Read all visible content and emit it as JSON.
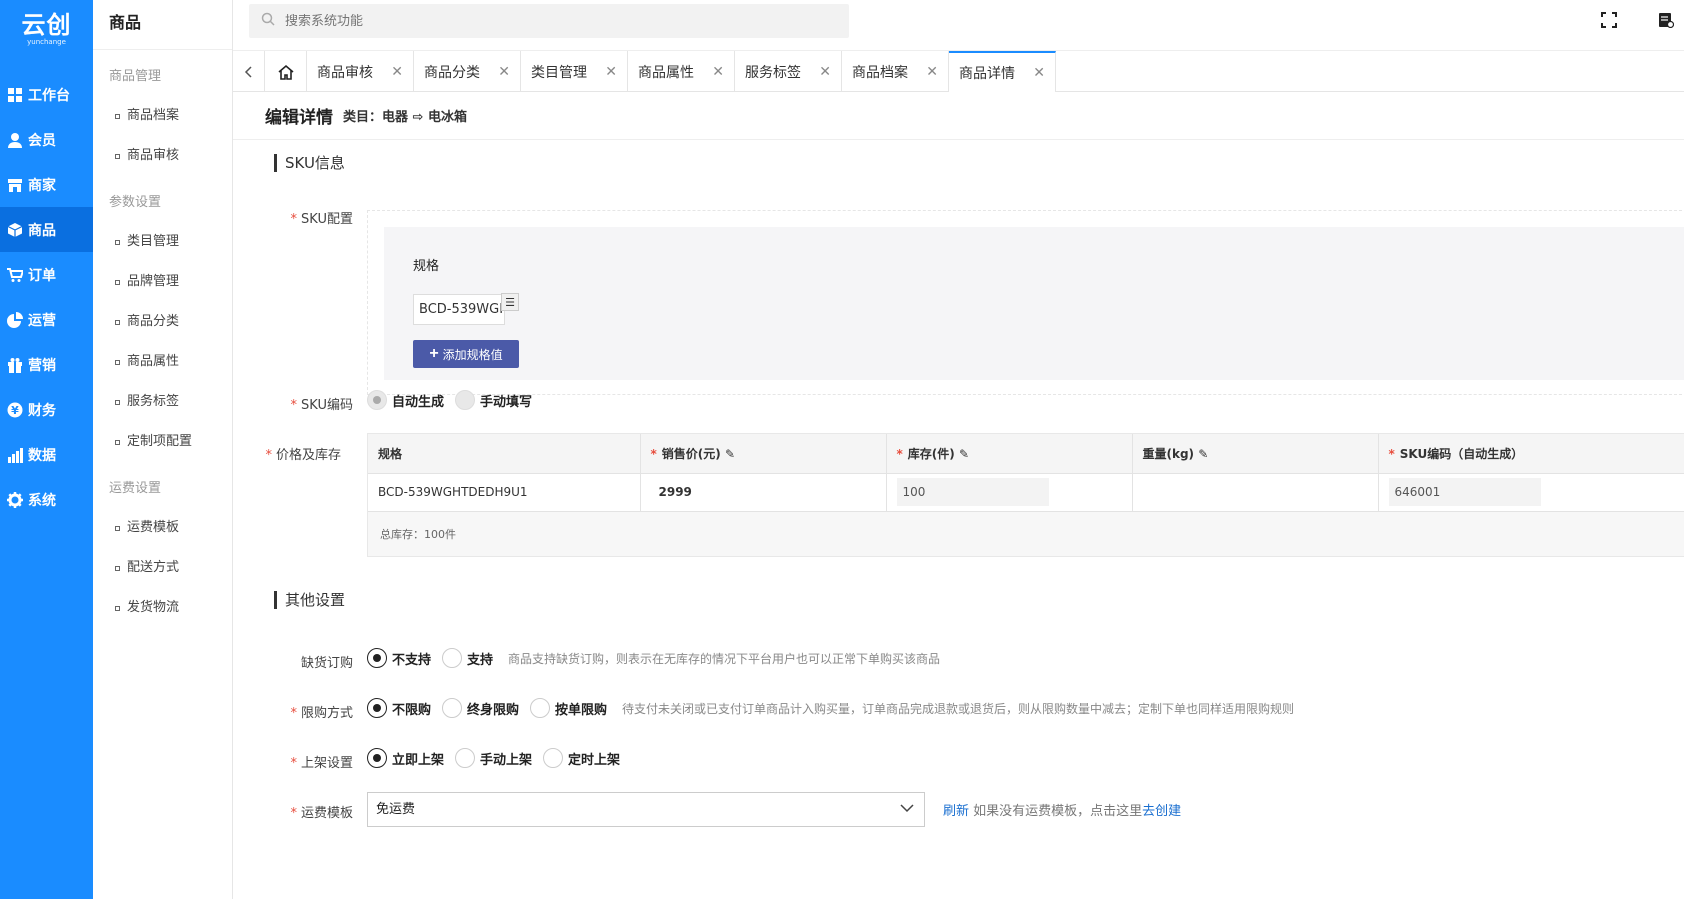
{
  "brand": {
    "name": "云创",
    "sub": "yunchange"
  },
  "nav1": [
    {
      "icon": "dashboard-icon",
      "label": "工作台"
    },
    {
      "icon": "user-icon",
      "label": "会员"
    },
    {
      "icon": "store-icon",
      "label": "商家"
    },
    {
      "icon": "cube-icon",
      "label": "商品"
    },
    {
      "icon": "cart-icon",
      "label": "订单"
    },
    {
      "icon": "pie-chart-icon",
      "label": "运营"
    },
    {
      "icon": "gift-icon",
      "label": "营销"
    },
    {
      "icon": "yen-icon",
      "label": "财务"
    },
    {
      "icon": "bar-chart-icon",
      "label": "数据"
    },
    {
      "icon": "gear-icon",
      "label": "系统"
    }
  ],
  "nav2": {
    "title": "商品",
    "groups": [
      {
        "title": "商品管理",
        "items": [
          "商品档案",
          "商品审核"
        ]
      },
      {
        "title": "参数设置",
        "items": [
          "类目管理",
          "品牌管理",
          "商品分类",
          "商品属性",
          "服务标签",
          "定制项配置"
        ]
      },
      {
        "title": "运费设置",
        "items": [
          "运费模板",
          "配送方式",
          "发货物流"
        ]
      }
    ]
  },
  "search": {
    "placeholder": "搜索系统功能"
  },
  "tabs": [
    "商品审核",
    "商品分类",
    "类目管理",
    "商品属性",
    "服务标签",
    "商品档案",
    "商品详情"
  ],
  "page": {
    "title": "编辑详情",
    "category": "类目：电器 ⇨ 电冰箱"
  },
  "sku_section": {
    "title": "SKU信息",
    "config_label": "SKU配置",
    "spec_label": "规格",
    "spec_value": "BCD-539WGHTDEDH9U1",
    "add_button": "添加规格值",
    "code_label": "SKU编码",
    "code_options": [
      "自动生成",
      "手动填写"
    ],
    "price_label": "价格及库存",
    "table_headers": [
      "规格",
      "销售价(元)",
      "库存(件)",
      "重量(kg)",
      "SKU编码（自动生成）"
    ],
    "table_row": {
      "spec": "BCD-539WGHTDEDH9U1",
      "price": "2999",
      "stock": "100",
      "weight": "",
      "code": "646001"
    },
    "total": "总库存：100件"
  },
  "other_section": {
    "title": "其他设置",
    "backorder": {
      "label": "缺货订购",
      "options": [
        "不支持",
        "支持"
      ],
      "hint": "商品支持缺货订购，则表示在无库存的情况下平台用户也可以正常下单购买该商品"
    },
    "limit": {
      "label": "限购方式",
      "options": [
        "不限购",
        "终身限购",
        "按单限购"
      ],
      "hint": "待支付未关闭或已支付订单商品计入购买量，订单商品完成退款或退货后，则从限购数量中减去；定制下单也同样适用限购规则"
    },
    "shelf": {
      "label": "上架设置",
      "options": [
        "立即上架",
        "手动上架",
        "定时上架"
      ]
    },
    "freight": {
      "label": "运费模板",
      "value": "免运费",
      "refresh": "刷新",
      "hint": "如果没有运费模板，点击这里",
      "create": "去创建"
    }
  }
}
